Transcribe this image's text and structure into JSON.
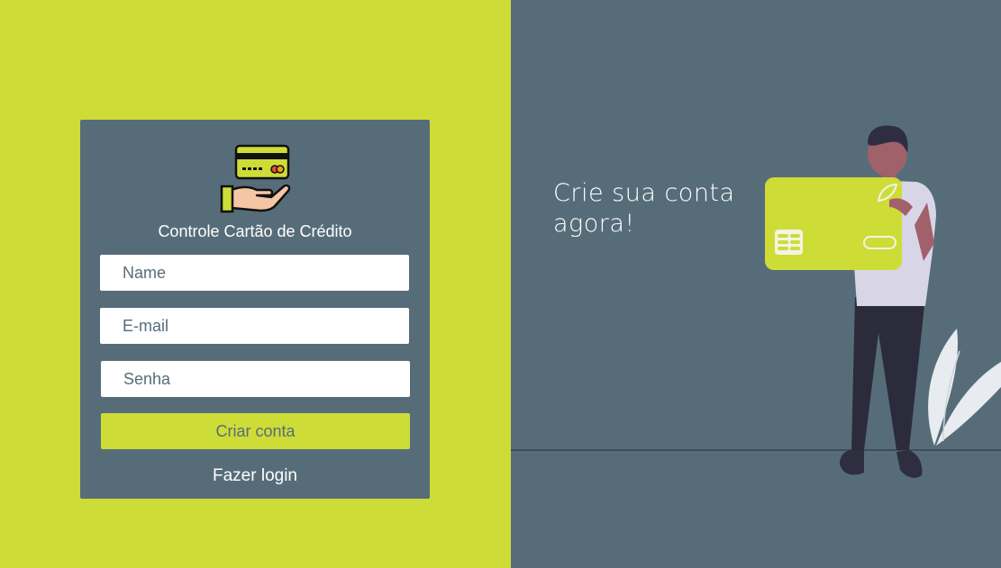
{
  "app": {
    "title": "Controle Cartão de Crédito",
    "logo_icon": "credit-card-in-hand-icon"
  },
  "form": {
    "name_placeholder": "Name",
    "email_placeholder": "E-mail",
    "password_placeholder": "Senha",
    "submit_label": "Criar conta",
    "login_link_label": "Fazer login"
  },
  "hero": {
    "headline_line1": "Crie sua conta",
    "headline_line2": "agora!",
    "illustration_icon": "person-holding-credit-card-icon"
  },
  "colors": {
    "accent": "#cedc37",
    "panel": "#566d79",
    "text_light": "#ffffff"
  }
}
